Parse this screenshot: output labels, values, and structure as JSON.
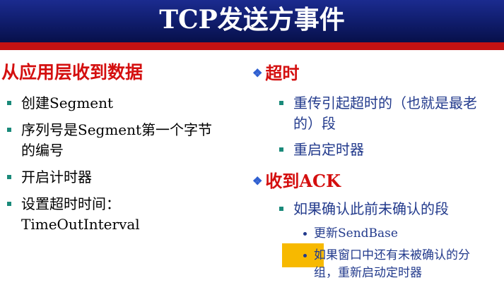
{
  "slide": {
    "title": "TCP发送方事件"
  },
  "left": {
    "heading": "从应用层收到数据",
    "items": [
      "创建Segment",
      "序列号是Segment第一个字节的编号",
      "开启计时器",
      "设置超时时间：TimeOutInterval"
    ]
  },
  "timeout": {
    "heading": "超时",
    "items": [
      "重传引起超时的（也就是最老的）段",
      "重启定时器"
    ]
  },
  "ack": {
    "heading": "收到ACK",
    "items": [
      "如果确认此前未确认的段"
    ],
    "sub_items": [
      "更新SendBase",
      "如果窗口中还有未被确认的分组，重新启动定时器"
    ]
  },
  "colors": {
    "title_band": "#0f1c6a",
    "accent_bar": "#c41212",
    "heading_red": "#d40f0f",
    "body_blue": "#223a8c",
    "bullet_teal": "#1a8a7a",
    "diamond_blue": "#2f5fd0",
    "highlight_yellow": "#f7b900"
  },
  "icons": {
    "heading_marker": "diamond-bullet-icon",
    "list_marker": "square-bullet-icon",
    "sub_list_marker": "dot-bullet-icon"
  }
}
